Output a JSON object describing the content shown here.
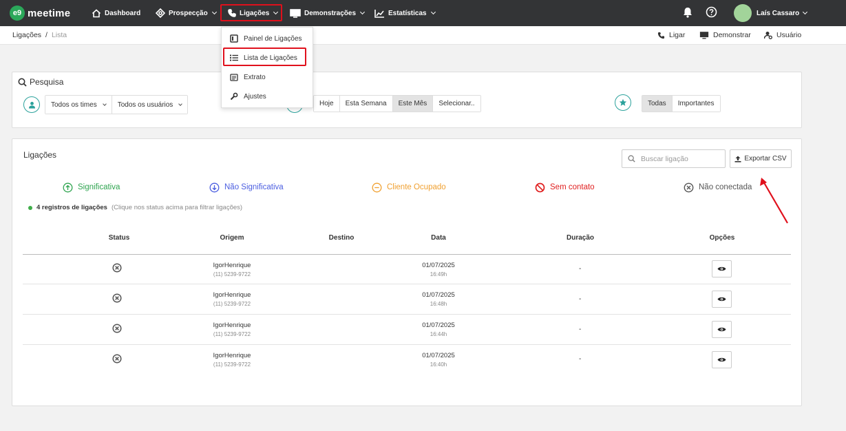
{
  "topbar": {
    "logo_badge": "e9",
    "logo_text": "meetime",
    "nav": [
      {
        "label": "Dashboard",
        "icon": "home-icon"
      },
      {
        "label": "Prospecção",
        "icon": "target-icon"
      },
      {
        "label": "Ligações",
        "icon": "phone-icon"
      },
      {
        "label": "Demonstrações",
        "icon": "monitor-icon"
      },
      {
        "label": "Estatísticas",
        "icon": "chart-icon"
      }
    ],
    "user_name": "Laís Cassaro"
  },
  "breadcrumb": {
    "parent": "Ligações",
    "separator": "/",
    "current": "Lista"
  },
  "sub_actions": {
    "call": "Ligar",
    "demo": "Demonstrar",
    "user": "Usuário"
  },
  "dropdown": {
    "items": [
      {
        "label": "Painel de Ligações",
        "icon": "panel-icon"
      },
      {
        "label": "Lista de Ligações",
        "icon": "list-icon"
      },
      {
        "label": "Extrato",
        "icon": "statement-icon"
      },
      {
        "label": "Ajustes",
        "icon": "wrench-icon"
      }
    ]
  },
  "search_panel": {
    "title": "Pesquisa",
    "team_select": "Todos os times",
    "user_select": "Todos os usuários",
    "period_options": [
      "Hoje",
      "Esta Semana",
      "Este Mês",
      "Selecionar.."
    ],
    "period_selected": "Este Mês",
    "priority_options": [
      "Todas",
      "Importantes"
    ],
    "priority_selected": "Todas"
  },
  "calls_panel": {
    "title": "Ligações",
    "search_placeholder": "Buscar ligação",
    "export_label": "Exportar CSV",
    "status_filters": [
      {
        "label": "Significativa",
        "color": "#2ea44f"
      },
      {
        "label": "Não Significativa",
        "color": "#4a5de0"
      },
      {
        "label": "Cliente Ocupado",
        "color": "#f0a030"
      },
      {
        "label": "Sem contato",
        "color": "#e02020"
      },
      {
        "label": "Não conectada",
        "color": "#555555"
      }
    ],
    "records_count": "4 registros de ligações",
    "records_hint": "(Clique nos status acima para filtrar ligações)",
    "columns": [
      "Status",
      "Origem",
      "Destino",
      "Data",
      "Duração",
      "Opções"
    ],
    "rows": [
      {
        "origin_name": "IgorHenrique",
        "origin_phone": "(11) 5239-9722",
        "date": "01/07/2025",
        "time": "16:49h",
        "duration": "-"
      },
      {
        "origin_name": "IgorHenrique",
        "origin_phone": "(11) 5239-9722",
        "date": "01/07/2025",
        "time": "16:48h",
        "duration": "-"
      },
      {
        "origin_name": "IgorHenrique",
        "origin_phone": "(11) 5239-9722",
        "date": "01/07/2025",
        "time": "16:44h",
        "duration": "-"
      },
      {
        "origin_name": "IgorHenrique",
        "origin_phone": "(11) 5239-9722",
        "date": "01/07/2025",
        "time": "16:40h",
        "duration": "-"
      }
    ]
  },
  "colors": {
    "topbar": "#333436",
    "brand": "#2ba85a",
    "highlight": "#e0101c",
    "teal": "#2aa19b"
  }
}
